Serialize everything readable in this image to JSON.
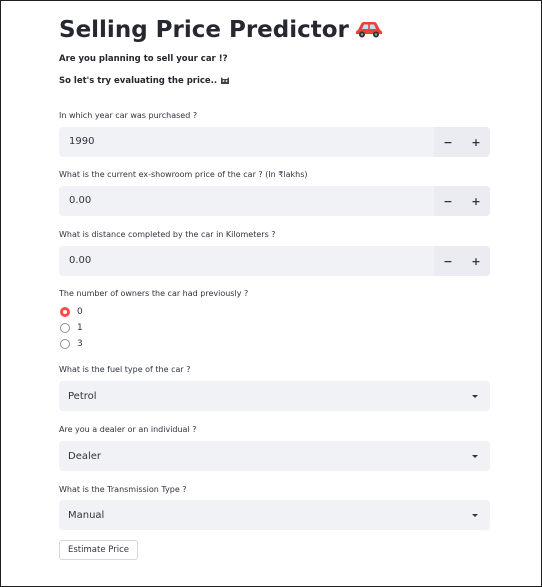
{
  "header": {
    "title": "Selling Price Predictor",
    "title_icon": "car-emoji"
  },
  "intro": {
    "line1": "Are you planning to sell your car !?",
    "line2": "So let's try evaluating the price..",
    "line2_icon": "cat-face-emoji"
  },
  "year": {
    "label": "In which year car was purchased ?",
    "value": "1990",
    "minus": "−",
    "plus": "+"
  },
  "price": {
    "label": "What is the current ex-showroom price of the car ? (In ₹lakhs)",
    "value": "0.00",
    "minus": "−",
    "plus": "+"
  },
  "distance": {
    "label": "What is distance completed by the car in Kilometers ?",
    "value": "0.00",
    "minus": "−",
    "plus": "+"
  },
  "owners": {
    "label": "The number of owners the car had previously ?",
    "options": [
      "0",
      "1",
      "3"
    ],
    "selected": "0"
  },
  "fuel": {
    "label": "What is the fuel type of the car ?",
    "value": "Petrol"
  },
  "seller": {
    "label": "Are you a dealer or an individual ?",
    "value": "Dealer"
  },
  "transmission": {
    "label": "What is the Transmission Type ?",
    "value": "Manual"
  },
  "actions": {
    "estimate_label": "Estimate Price"
  },
  "colors": {
    "accent": "#ff4b4b",
    "input_bg": "#f0f2f6",
    "text": "#262730"
  }
}
